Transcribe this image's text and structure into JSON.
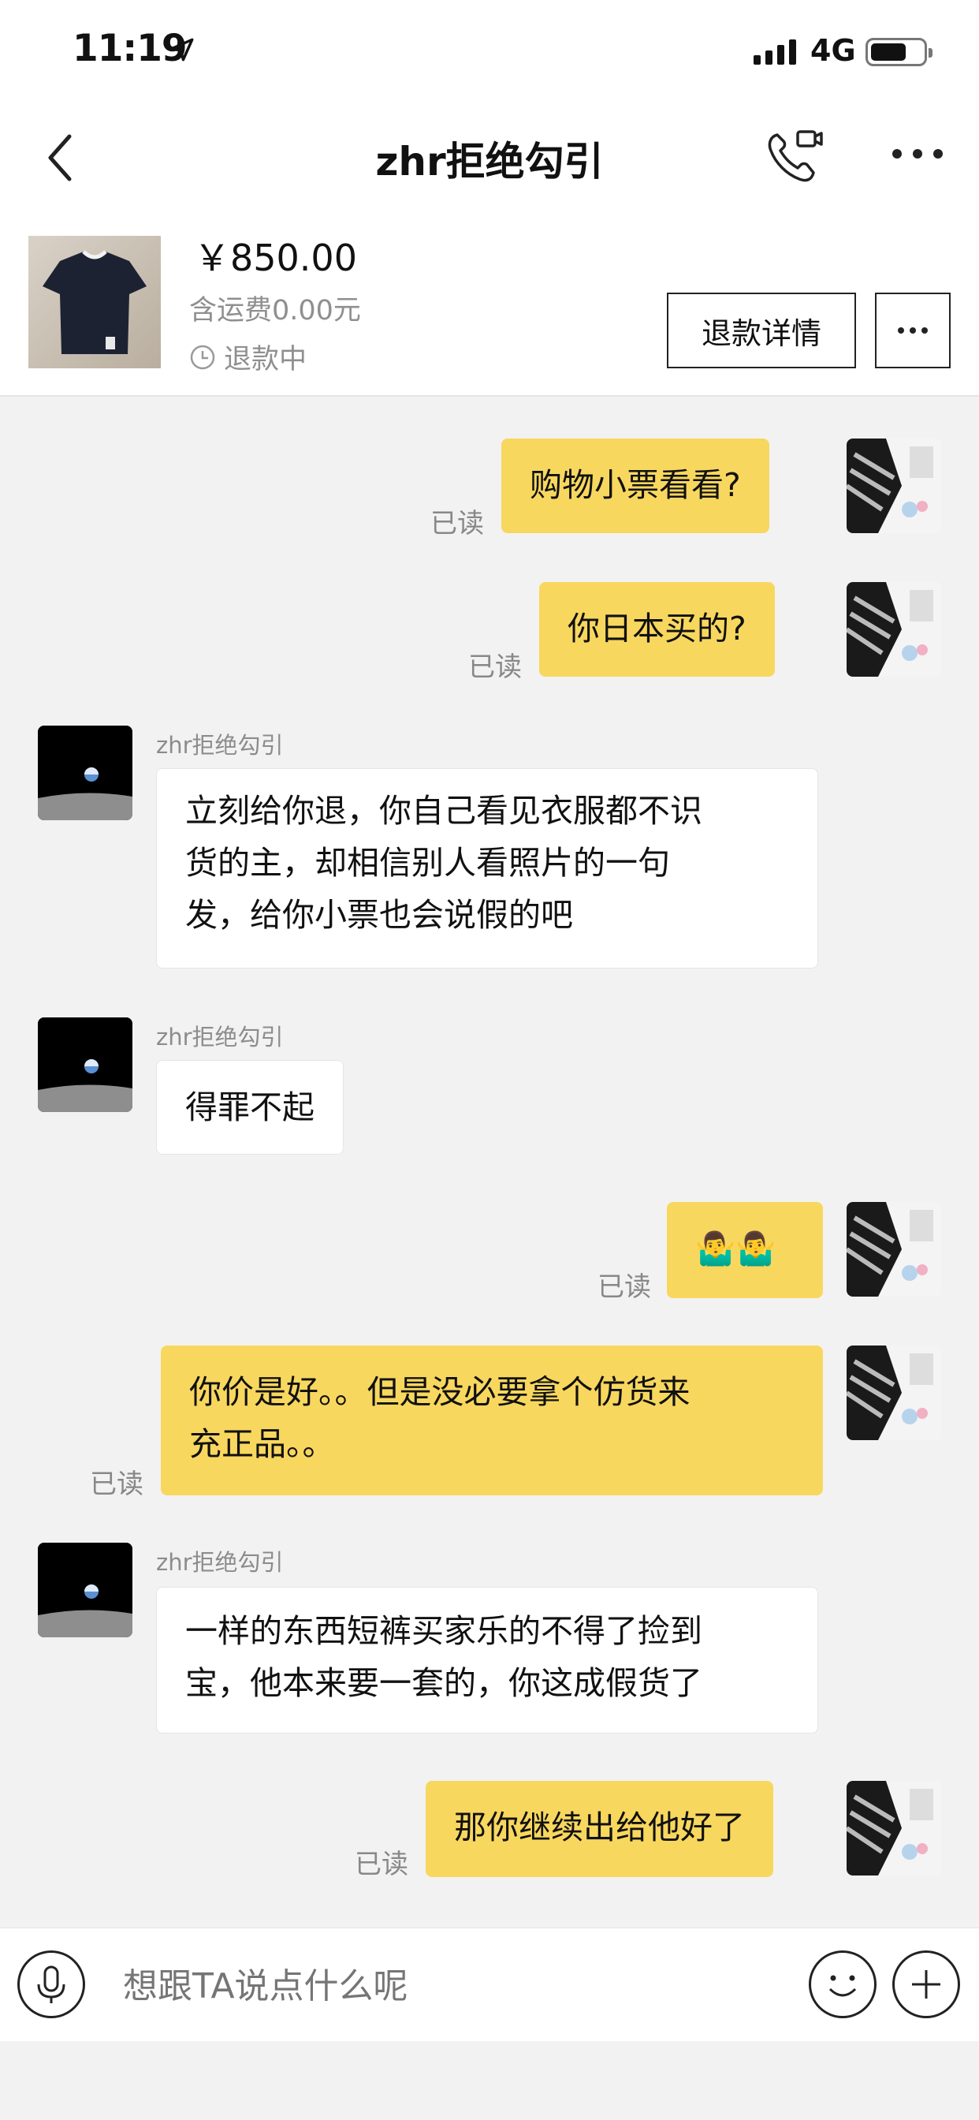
{
  "status_bar": {
    "time": "11:19",
    "network": "4G",
    "icons": [
      "location-arrow-icon",
      "signal-icon",
      "battery-icon"
    ]
  },
  "header": {
    "title": "zhr拒绝勾引",
    "icons": [
      "back-chevron-icon",
      "video-call-icon",
      "more-icon"
    ]
  },
  "product": {
    "price": "￥850.00",
    "shipping": "含运费0.00元",
    "status": "退款中",
    "refund_button": "退款详情",
    "icons": [
      "tshirt-thumbnail",
      "clock-icon",
      "more-icon"
    ]
  },
  "messages": [
    {
      "from": "me",
      "text": "购物小票看看?",
      "read": "已读"
    },
    {
      "from": "me",
      "text": "你日本买的?",
      "read": "已读"
    },
    {
      "from": "them",
      "sender": "zhr拒绝勾引",
      "lines": [
        "立刻给你退，你自己看见衣服都不识",
        "货的主，却相信别人看照片的一句",
        "发，给你小票也会说假的吧"
      ]
    },
    {
      "from": "them",
      "sender": "zhr拒绝勾引",
      "text": "得罪不起"
    },
    {
      "from": "me",
      "text": "🤷‍♂️🤷‍♂️",
      "read": "已读"
    },
    {
      "from": "me",
      "lines": [
        "你价是好。。但是没必要拿个仿货来",
        "充正品。。"
      ],
      "read": "已读"
    },
    {
      "from": "them",
      "sender": "zhr拒绝勾引",
      "lines": [
        "一样的东西短裤买家乐的不得了捡到",
        "宝，他本来要一套的，你这成假货了"
      ]
    },
    {
      "from": "me",
      "text": "那你继续出给他好了",
      "read": "已读"
    }
  ],
  "input": {
    "placeholder": "想跟TA说点什么呢",
    "icons": [
      "microphone-icon",
      "emoji-icon",
      "plus-icon"
    ]
  }
}
